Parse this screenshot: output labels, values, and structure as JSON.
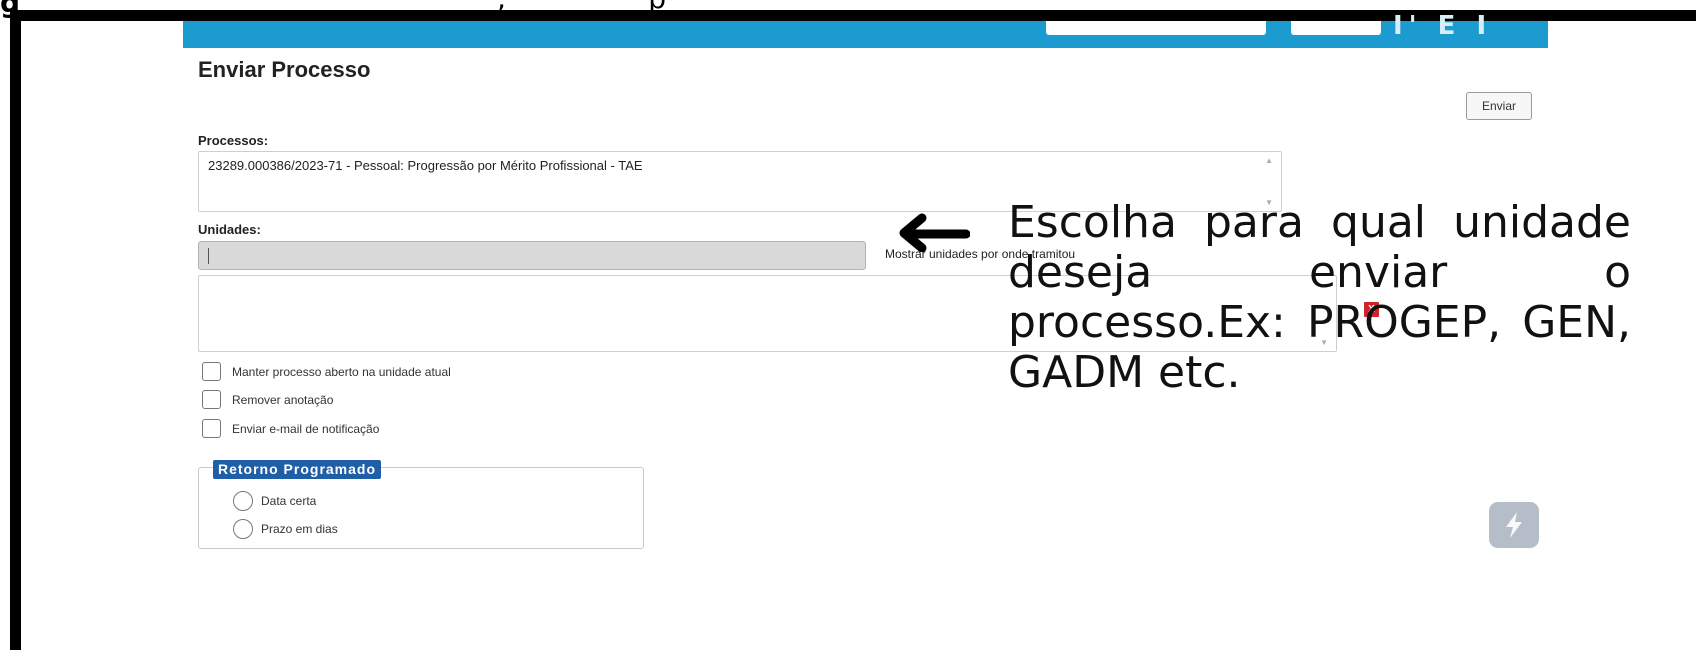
{
  "header": {
    "title": "Enviar Processo",
    "send_label": "Enviar"
  },
  "processos": {
    "label": "Processos:",
    "items": [
      "23289.000386/2023-71 - Pessoal: Progressão por Mérito Profissional - TAE"
    ]
  },
  "unidades": {
    "label": "Unidades:",
    "input_value": "",
    "show_units_link": "Mostrar unidades por onde tramitou",
    "remove_label": "X"
  },
  "options": [
    {
      "label": "Manter processo aberto na unidade atual",
      "checked": false
    },
    {
      "label": "Remover anotação",
      "checked": false
    },
    {
      "label": "Enviar e-mail de notificação",
      "checked": false
    }
  ],
  "retorno": {
    "legend": "Retorno Programado",
    "radios": [
      {
        "label": "Data certa",
        "selected": false
      },
      {
        "label": "Prazo em dias",
        "selected": false
      }
    ]
  },
  "annotation": {
    "text": "Escolha para qual unidade deseja enviar o processo.Ex: PROGEP, GEN, GADM etc."
  },
  "colors": {
    "topbar": "#1c9bd0",
    "legend_bg": "#1f5fa8",
    "remove_icon": "#d0222b"
  },
  "icons": [
    "arrow-left-icon",
    "remove-x-icon",
    "lightning-icon"
  ]
}
